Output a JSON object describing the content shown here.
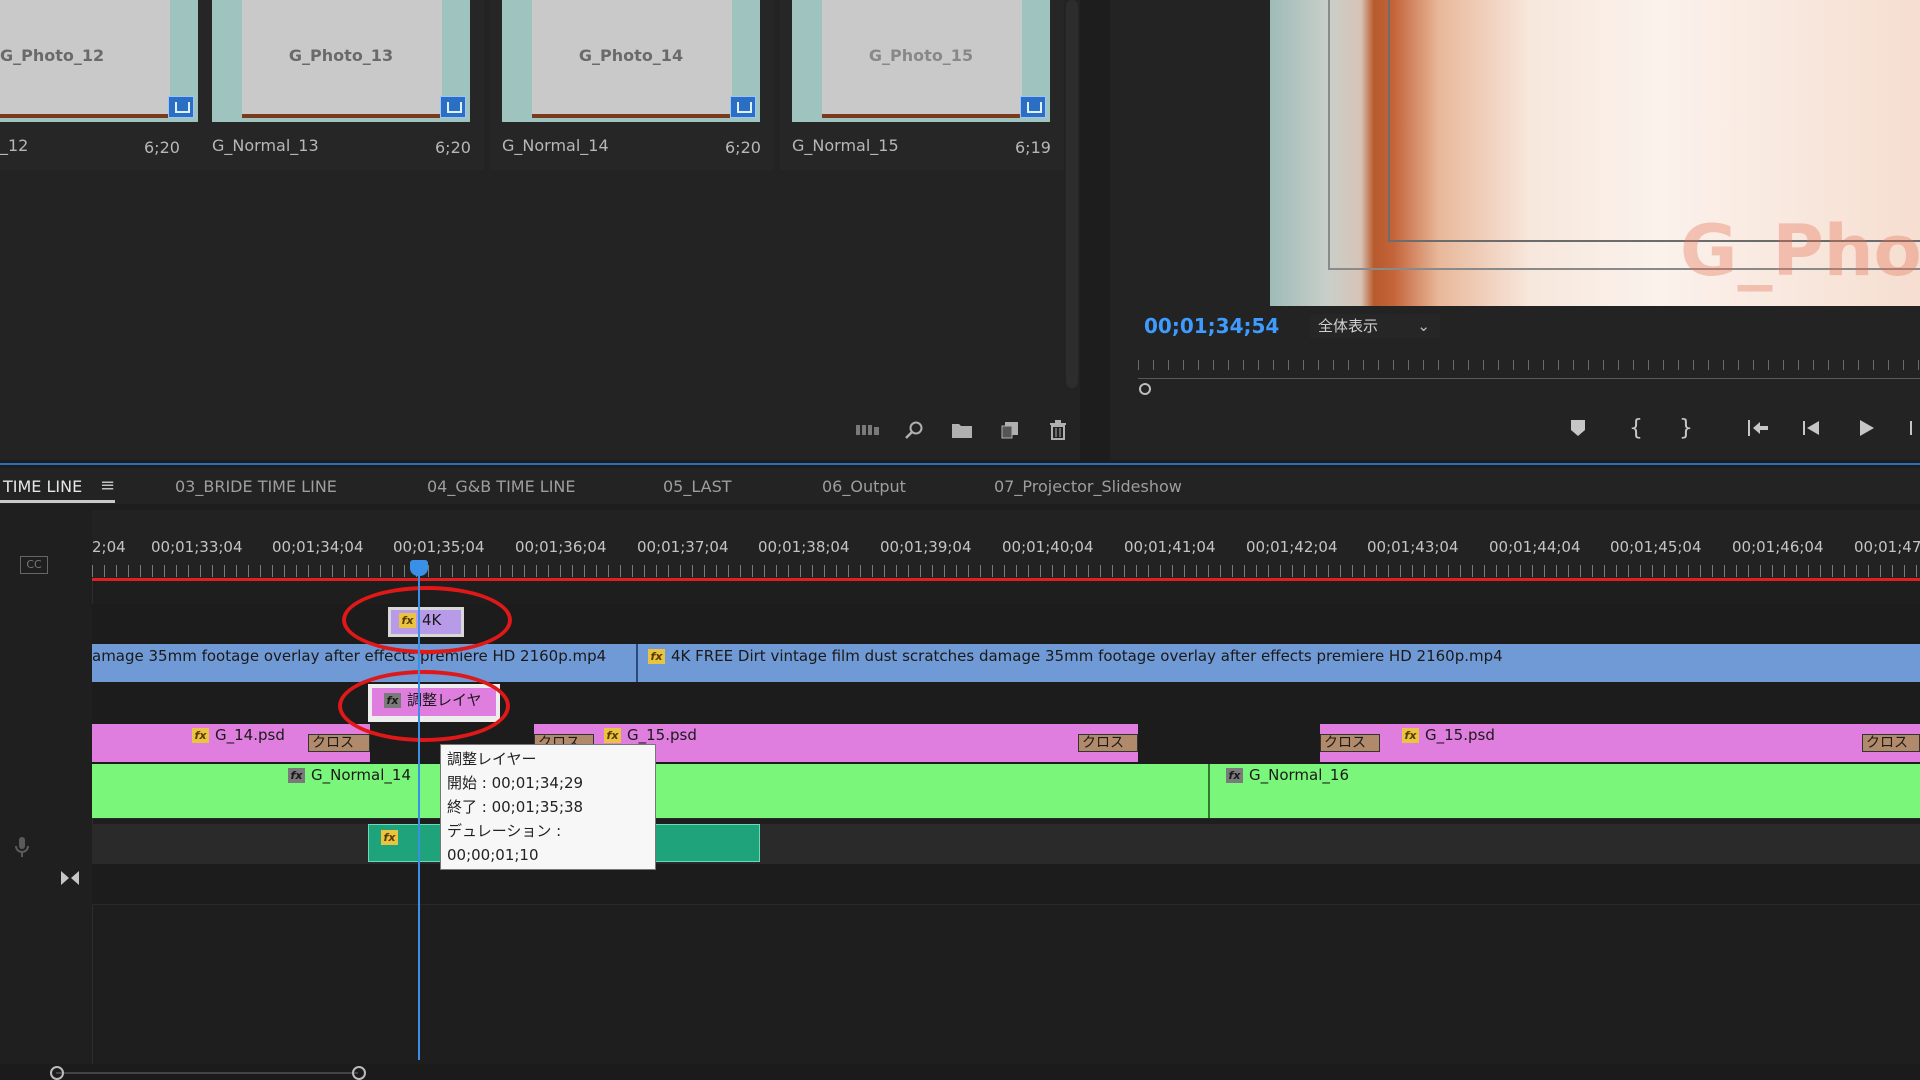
{
  "bin": {
    "items": [
      {
        "title": "G_Photo_12",
        "caption": "_12",
        "duration": "6;20"
      },
      {
        "title": "G_Photo_13",
        "caption": "G_Normal_13",
        "duration": "6;20"
      },
      {
        "title": "G_Photo_14",
        "caption": "G_Normal_14",
        "duration": "6;20"
      },
      {
        "title": "G_Photo_15",
        "caption": "G_Normal_15",
        "duration": "6;19"
      }
    ],
    "toolbar": [
      "list-view-icon",
      "search-icon",
      "new-bin-icon",
      "new-item-icon",
      "trash-icon"
    ]
  },
  "monitor": {
    "timecode": "00;01;34;54",
    "zoom": "全体表示",
    "watermark": "G_Phot"
  },
  "timeline": {
    "menu_icon": "≡",
    "tabs": [
      "TIME LINE",
      "03_BRIDE TIME LINE",
      "04_G&B TIME LINE",
      "05_LAST",
      "06_Output",
      "07_Projector_Slideshow"
    ],
    "ruler_labels": [
      "2;04",
      "00;01;33;04",
      "00;01;34;04",
      "00;01;35;04",
      "00;01;36;04",
      "00;01;37;04",
      "00;01;38;04",
      "00;01;39;04",
      "00;01;40;04",
      "00;01;41;04",
      "00;01;42;04",
      "00;01;43;04",
      "00;01;44;04",
      "00;01;45;04",
      "00;01;46;04",
      "00;01;47"
    ],
    "cc": "CC",
    "clips": {
      "adj_4k": "4K",
      "video_a": "amage 35mm footage overlay after effects premiere HD 2160p.mp4",
      "video_b": "4K FREE Dirt vintage film dust scratches damage 35mm footage overlay after effects premiere HD 2160p.mp4",
      "adj_layer": "調整レイヤ",
      "g14": "G_14.psd",
      "g15a": "G_15.psd",
      "g15b": "G_15.psd",
      "cross": "クロス",
      "norm14": "G_Normal_14",
      "norm16": "G_Normal_16",
      "fx": "fx"
    },
    "tooltip": {
      "line1": "調整レイヤー",
      "line2": "開始 : 00;01;34;29",
      "line3": "終了 : 00;01;35;38",
      "line4": "デュレーション : 00;00;01;10"
    },
    "accent_colors": {
      "playhead": "#3a8fe6",
      "video_track": "#6f9ad6",
      "psd_track": "#e07ee0",
      "normal_track": "#7af77a",
      "audio": "#1fa37a",
      "highlight": "#e01818"
    }
  }
}
